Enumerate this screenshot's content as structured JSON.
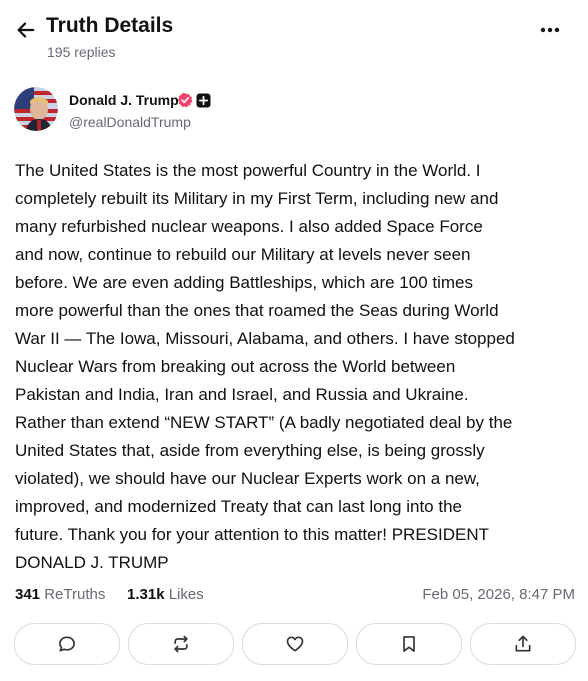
{
  "header": {
    "back_icon": "arrow-left-icon",
    "title": "Truth Details",
    "replies": "195 replies",
    "more_icon": "more-horizontal-icon"
  },
  "author": {
    "display_name": "Donald J. Trump",
    "handle": "@realDonaldTrump",
    "verified_icon": "verified-badge-icon",
    "verified_color": "#f0446e",
    "plus_icon": "plus-badge-icon"
  },
  "post": {
    "text": "The United States is the most powerful Country in the World. I\ncompletely rebuilt its Military in my First Term, including new and\nmany refurbished nuclear weapons. I also added Space Force\nand now, continue to rebuild our Military at levels never seen\nbefore. We are even adding Battleships, which are 100 times\nmore powerful than the ones that roamed the Seas during World\nWar II — The Iowa, Missouri, Alabama, and others. I have stopped\nNuclear Wars from breaking out across the World between\nPakistan and India, Iran and Israel, and Russia and Ukraine.\nRather than extend “NEW START” (A badly negotiated deal by the\nUnited States that, aside from everything else, is being grossly\nviolated), we should have our Nuclear Experts work on a new,\nimproved, and modernized Treaty that can last long into the\nfuture. Thank you for your attention to this matter! PRESIDENT\nDONALD J. TRUMP"
  },
  "stats": {
    "retruths_count": "341",
    "retruths_label": "ReTruths",
    "likes_count": "1.31k",
    "likes_label": "Likes",
    "timestamp": "Feb 05, 2026, 8:47 PM"
  },
  "actions": [
    {
      "icon": "comment-icon"
    },
    {
      "icon": "retruth-icon"
    },
    {
      "icon": "heart-icon"
    },
    {
      "icon": "bookmark-icon"
    },
    {
      "icon": "share-icon"
    }
  ]
}
